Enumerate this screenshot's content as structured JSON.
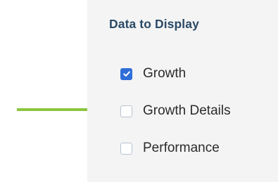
{
  "panel": {
    "title": "Data to Display",
    "options": [
      {
        "label": "Growth",
        "checked": true
      },
      {
        "label": "Growth Details",
        "checked": false
      },
      {
        "label": "Performance",
        "checked": false
      }
    ]
  },
  "colors": {
    "panel_background": "#f4f4f4",
    "title_text": "#2a4a66",
    "checkbox_checked": "#2f6ed8",
    "checkbox_border": "#b8c3ce",
    "pointer_line": "#8cc63f"
  },
  "icons": {
    "check": "checkmark-icon",
    "pointer": "callout-pointer-line"
  }
}
